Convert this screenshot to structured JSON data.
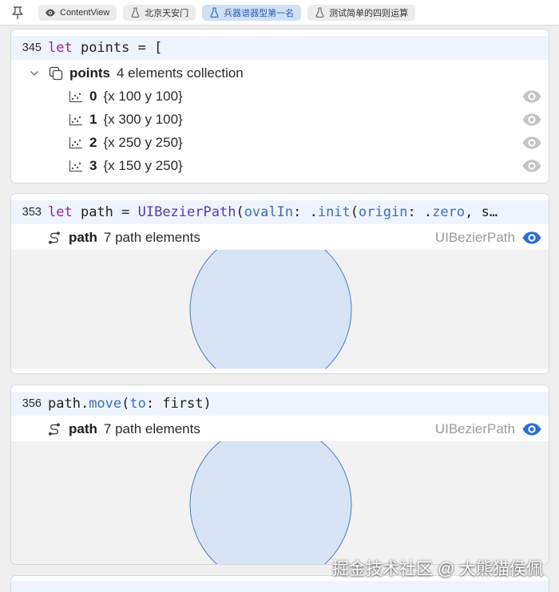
{
  "tabs": [
    {
      "label": "ContentView",
      "icon": "eye-icon",
      "active": false
    },
    {
      "label": "北京天安门",
      "icon": "flask-icon",
      "active": false
    },
    {
      "label": "兵器谱器型第一名",
      "icon": "flask-icon",
      "active": true
    },
    {
      "label": "测试简单的四则运算",
      "icon": "flask-icon",
      "active": false
    }
  ],
  "results": [
    {
      "line": "345",
      "code": "let points = [",
      "summary": {
        "name": "points",
        "desc": "4 elements collection"
      },
      "items": [
        {
          "index": "0",
          "value": "{x 100 y 100}"
        },
        {
          "index": "1",
          "value": "{x 300 y 100}"
        },
        {
          "index": "2",
          "value": "{x 250 y 250}"
        },
        {
          "index": "3",
          "value": "{x 150 y 250}"
        }
      ]
    },
    {
      "line": "353",
      "code": "let path = UIBezierPath(ovalIn: .init(origin: .zero, s…",
      "summary": {
        "name": "path",
        "desc": "7 path elements",
        "type": "UIBezierPath"
      }
    },
    {
      "line": "356",
      "code": "path.move(to: first)",
      "summary": {
        "name": "path",
        "desc": "7 path elements",
        "type": "UIBezierPath"
      }
    }
  ],
  "colors": {
    "accent": "#2b6fd6",
    "code_bg": "#eef4fd",
    "oval_fill": "#d6e4f6",
    "oval_stroke": "#4a7cbf"
  },
  "watermark": "掘金技术社区 @ 大熊猫侯佩"
}
